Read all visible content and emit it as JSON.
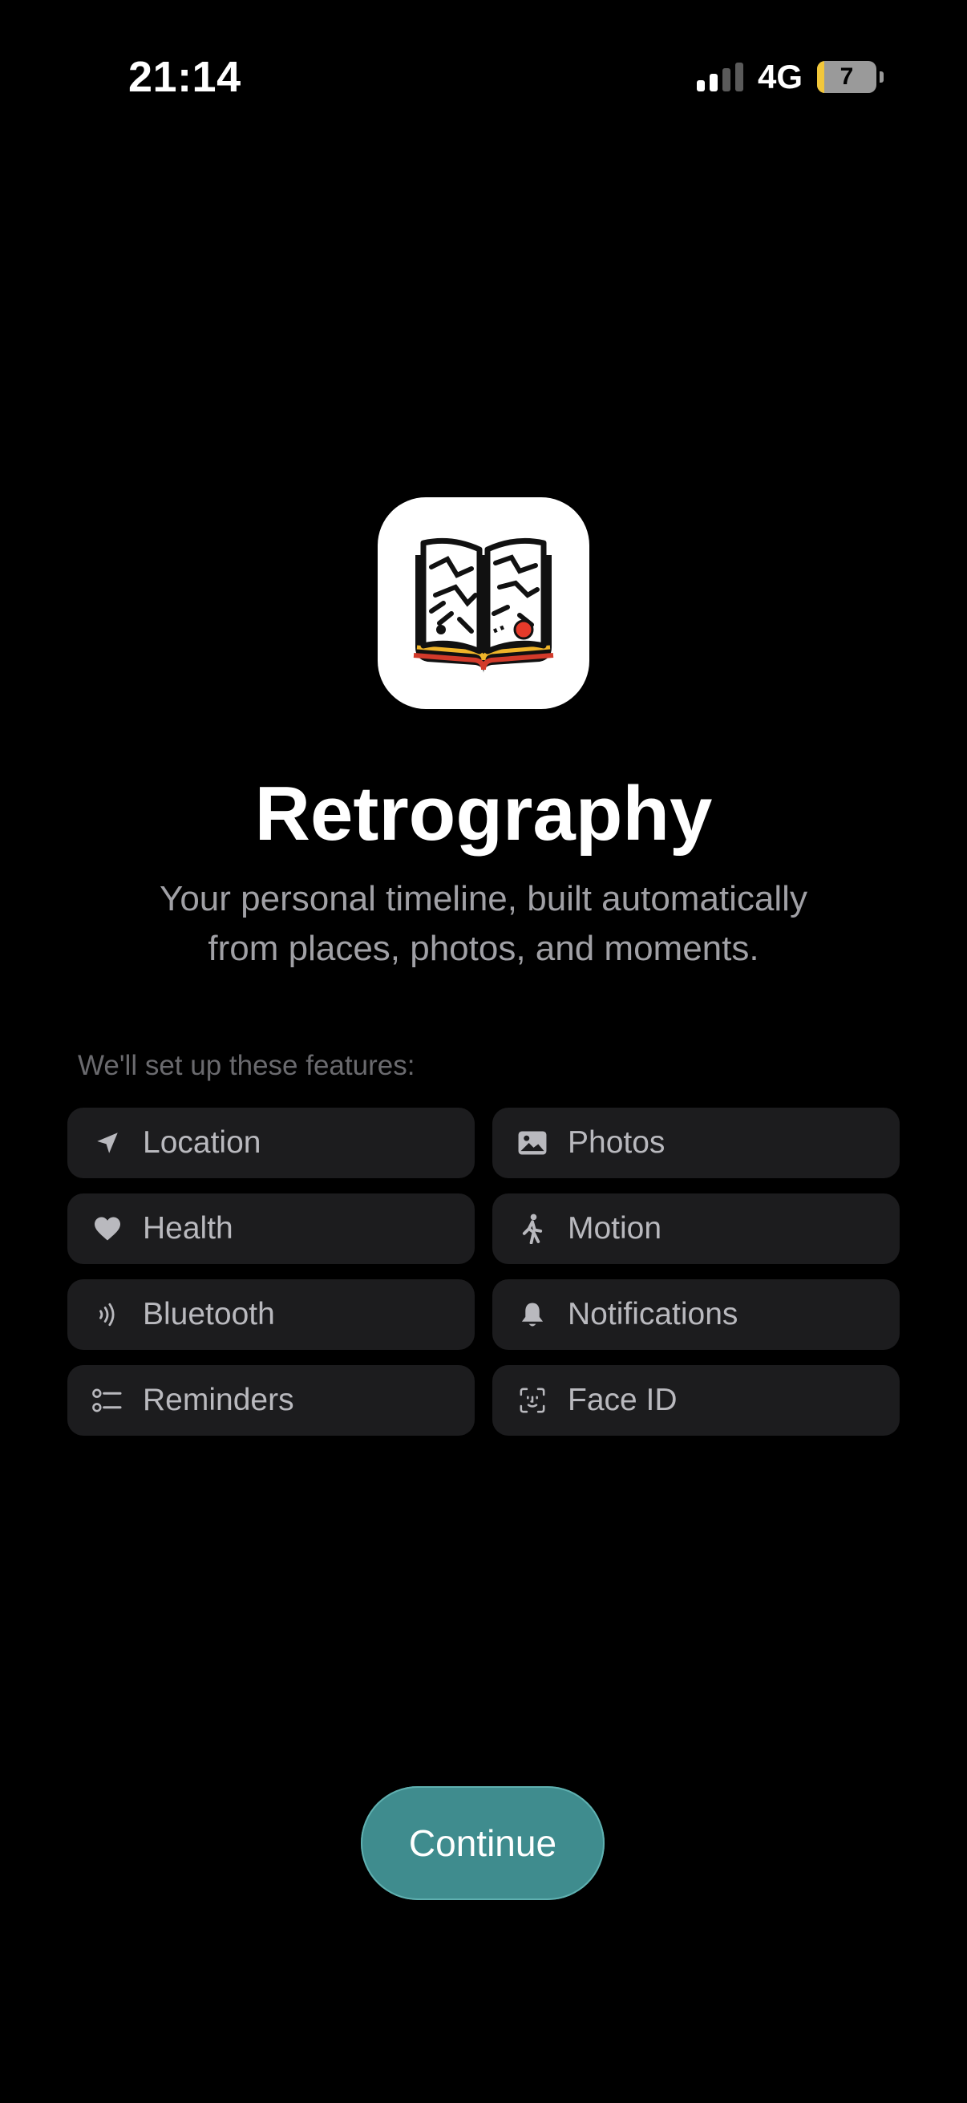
{
  "status_bar": {
    "time": "21:14",
    "network": "4G",
    "battery": "7"
  },
  "app": {
    "title": "Retrography",
    "subtitle_line1": "Your personal timeline, built automatically",
    "subtitle_line2": "from places, photos, and moments."
  },
  "features": {
    "heading": "We'll set up these features:",
    "items": [
      {
        "label": "Location",
        "icon": "location-arrow-icon"
      },
      {
        "label": "Photos",
        "icon": "photo-icon"
      },
      {
        "label": "Health",
        "icon": "heart-icon"
      },
      {
        "label": "Motion",
        "icon": "walking-figure-icon"
      },
      {
        "label": "Bluetooth",
        "icon": "signal-waves-icon"
      },
      {
        "label": "Notifications",
        "icon": "bell-icon"
      },
      {
        "label": "Reminders",
        "icon": "checklist-icon"
      },
      {
        "label": "Face ID",
        "icon": "face-id-icon"
      }
    ]
  },
  "actions": {
    "continue_label": "Continue"
  },
  "colors": {
    "background": "#000000",
    "chip_background": "#1c1c1e",
    "accent": "#3f8c8e"
  }
}
